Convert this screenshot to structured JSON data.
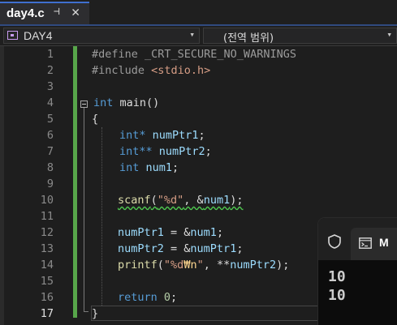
{
  "tab": {
    "title": "day4.c",
    "pin": "⊣",
    "close": "✕"
  },
  "navbar": {
    "project": "DAY4",
    "scope": "(전역 범위)",
    "chevron": "▾"
  },
  "editor": {
    "current_line": 17,
    "line_numbers": [
      "1",
      "2",
      "3",
      "4",
      "5",
      "6",
      "7",
      "8",
      "9",
      "10",
      "11",
      "12",
      "13",
      "14",
      "15",
      "16",
      "17"
    ],
    "lines": {
      "l1": "#define _CRT_SECURE_NO_WARNINGS",
      "l2_kw": "#include ",
      "l2_inc": "<stdio.h>",
      "l4_kw": "int",
      "l4_fn": " main()",
      "l5": "{",
      "l6_kw": "int*",
      "l6_var": " numPtr1",
      "l6_end": ";",
      "l7_kw": "int**",
      "l7_var": " numPtr2",
      "l7_end": ";",
      "l8_kw": "int",
      "l8_var": " num1",
      "l8_end": ";",
      "l10_fn": "scanf",
      "l10_open": "(",
      "l10_str": "\"%d\"",
      "l10_mid": ", &",
      "l10_var": "num1",
      "l10_end": ");",
      "l12_var": "numPtr1",
      "l12_mid": " = &",
      "l12_var2": "num1",
      "l12_end": ";",
      "l13_var": "numPtr2",
      "l13_mid": " = &",
      "l13_var2": "numPtr1",
      "l13_end": ";",
      "l14_fn": "printf",
      "l14_open": "(",
      "l14_str": "\"%d",
      "l14_esc": "₩n",
      "l14_str2": "\"",
      "l14_mid": ", **",
      "l14_var": "numPtr2",
      "l14_end": ");",
      "l16_kw": "return",
      "l16_num": " 0",
      "l16_end": ";",
      "l17": "}"
    }
  },
  "console": {
    "tab_label": "M",
    "output": [
      "10",
      "10"
    ]
  },
  "colors": {
    "accent": "#3f6fd0",
    "change_bar": "#57a64a",
    "keyword": "#569cd6",
    "function": "#dcdcaa",
    "variable": "#9cdcfe",
    "string": "#d69d85"
  }
}
